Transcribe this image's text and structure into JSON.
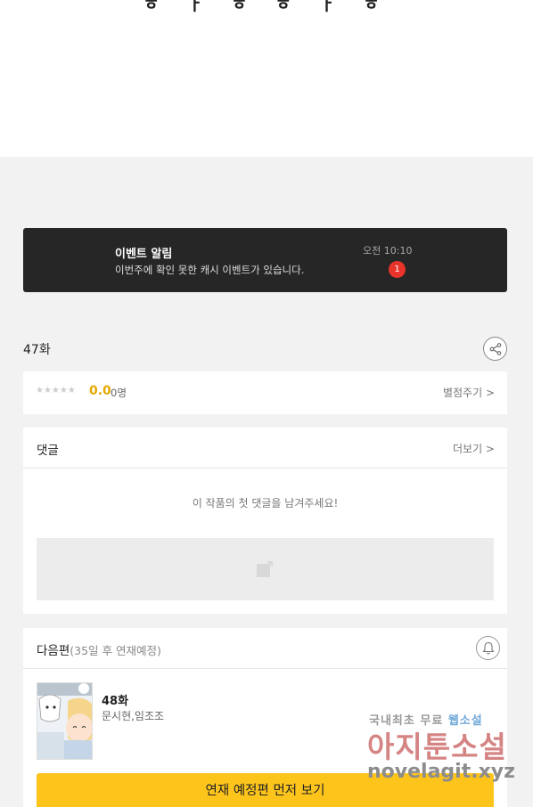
{
  "top": {
    "cropped_text": "ㅎ ㅏ ㅎ ㅎ ㅏ ㅎ"
  },
  "notification": {
    "title": "이벤트 알림",
    "body": "이번주에 확인 못한 캐시 이벤트가 있습니다.",
    "time": "오전 10:10",
    "badge": "1"
  },
  "episode": {
    "title": "47화"
  },
  "rating": {
    "stars": "★★★★★",
    "score": "0.0",
    "count": "0명",
    "link": "별점주기 >"
  },
  "comments": {
    "title": "댓글",
    "more": "더보기 >",
    "empty_message": "이 작품의 첫 댓글을 남겨주세요!"
  },
  "next": {
    "title": "다음편",
    "subtitle": "(35일 후 연재예정)",
    "episode": "48화",
    "authors": "문시현,임조조",
    "cta": "연재 예정편 먼저 보기"
  },
  "watermark": {
    "line1_a": "국내최초 무료",
    "line1_b": "웹소설",
    "line2": "아지툰소설",
    "line3": "novelagit.xyz"
  },
  "colors": {
    "accent_yellow": "#fdc51c",
    "badge_red": "#e8342a",
    "notif_bg": "#262626",
    "score": "#e5a800"
  }
}
